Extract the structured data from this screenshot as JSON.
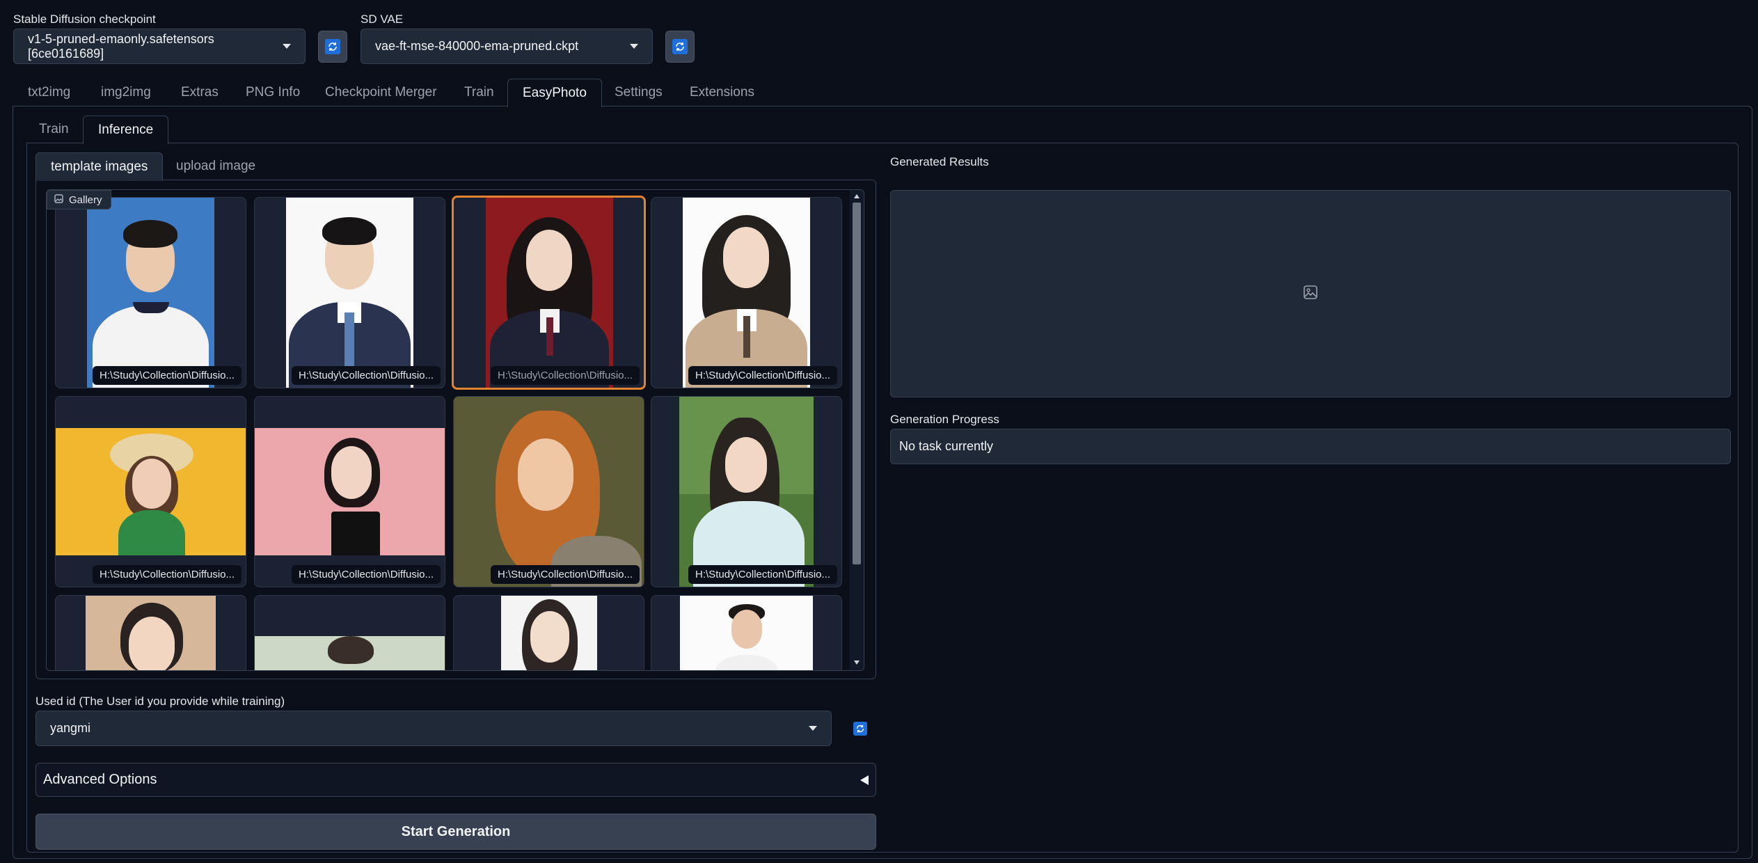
{
  "header": {
    "checkpoint_label": "Stable Diffusion checkpoint",
    "checkpoint_value": "v1-5-pruned-emaonly.safetensors [6ce0161689]",
    "vae_label": "SD VAE",
    "vae_value": "vae-ft-mse-840000-ema-pruned.ckpt"
  },
  "main_tabs": [
    "txt2img",
    "img2img",
    "Extras",
    "PNG Info",
    "Checkpoint Merger",
    "Train",
    "EasyPhoto",
    "Settings",
    "Extensions"
  ],
  "main_tab_selected": "EasyPhoto",
  "sub_tabs": [
    "Train",
    "Inference"
  ],
  "sub_tab_selected": "Inference",
  "source_tabs": [
    "template images",
    "upload image"
  ],
  "source_tab_selected": "template images",
  "gallery": {
    "label": "Gallery",
    "selected_index": 2,
    "items": [
      {
        "caption": "H:\\Study\\Collection\\Diffusio..."
      },
      {
        "caption": "H:\\Study\\Collection\\Diffusio..."
      },
      {
        "caption": "H:\\Study\\Collection\\Diffusio..."
      },
      {
        "caption": "H:\\Study\\Collection\\Diffusio..."
      },
      {
        "caption": "H:\\Study\\Collection\\Diffusio..."
      },
      {
        "caption": "H:\\Study\\Collection\\Diffusio..."
      },
      {
        "caption": "H:\\Study\\Collection\\Diffusio..."
      },
      {
        "caption": "H:\\Study\\Collection\\Diffusio..."
      },
      {
        "caption": ""
      },
      {
        "caption": ""
      },
      {
        "caption": ""
      },
      {
        "caption": ""
      }
    ]
  },
  "user_id": {
    "label": "Used id (The User id you provide while training)",
    "value": "yangmi"
  },
  "advanced_options_label": "Advanced Options",
  "start_button_label": "Start Generation",
  "results": {
    "label": "Generated Results",
    "progress_label": "Generation Progress",
    "progress_text": "No task currently"
  },
  "colors": {
    "background": "#0b0f19",
    "accent_selected": "#e3832f",
    "refresh_icon": "#1e6fd9"
  }
}
